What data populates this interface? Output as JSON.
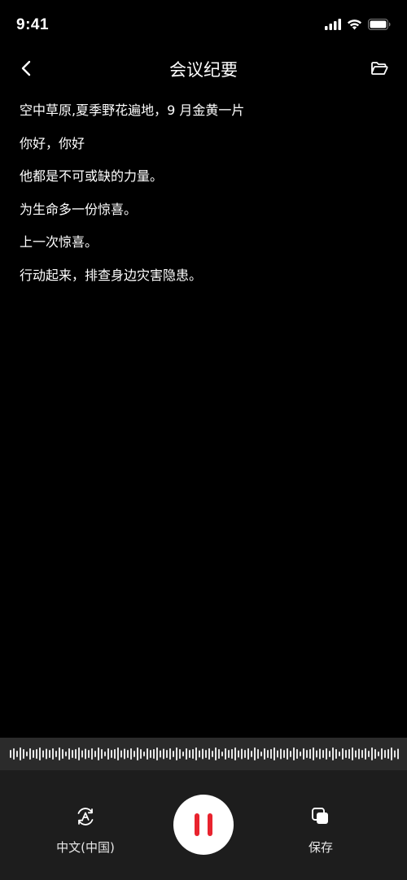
{
  "status_bar": {
    "time": "9:41",
    "icons": [
      "cellular-signal-icon",
      "wifi-icon",
      "battery-icon"
    ]
  },
  "nav": {
    "title": "会议纪要",
    "back_icon": "chevron-left-icon",
    "folder_icon": "folder-icon"
  },
  "transcript": {
    "lines": [
      "空中草原,夏季野花遍地，9 月金黄一片",
      "你好，你好",
      "他都是不可或缺的力量。",
      "为生命多一份惊喜。",
      "上一次惊喜。",
      "行动起来，排查身边灾害隐患。"
    ]
  },
  "controls": {
    "language_label": "中文(中国)",
    "language_icon": "language-a-icon",
    "pause_icon": "pause-icon",
    "save_label": "保存",
    "save_icon": "copy-stack-icon"
  },
  "colors": {
    "background": "#000000",
    "panel": "#1d1d1d",
    "waveform_bg": "#2b2b2b",
    "accent_red": "#e8232e"
  }
}
